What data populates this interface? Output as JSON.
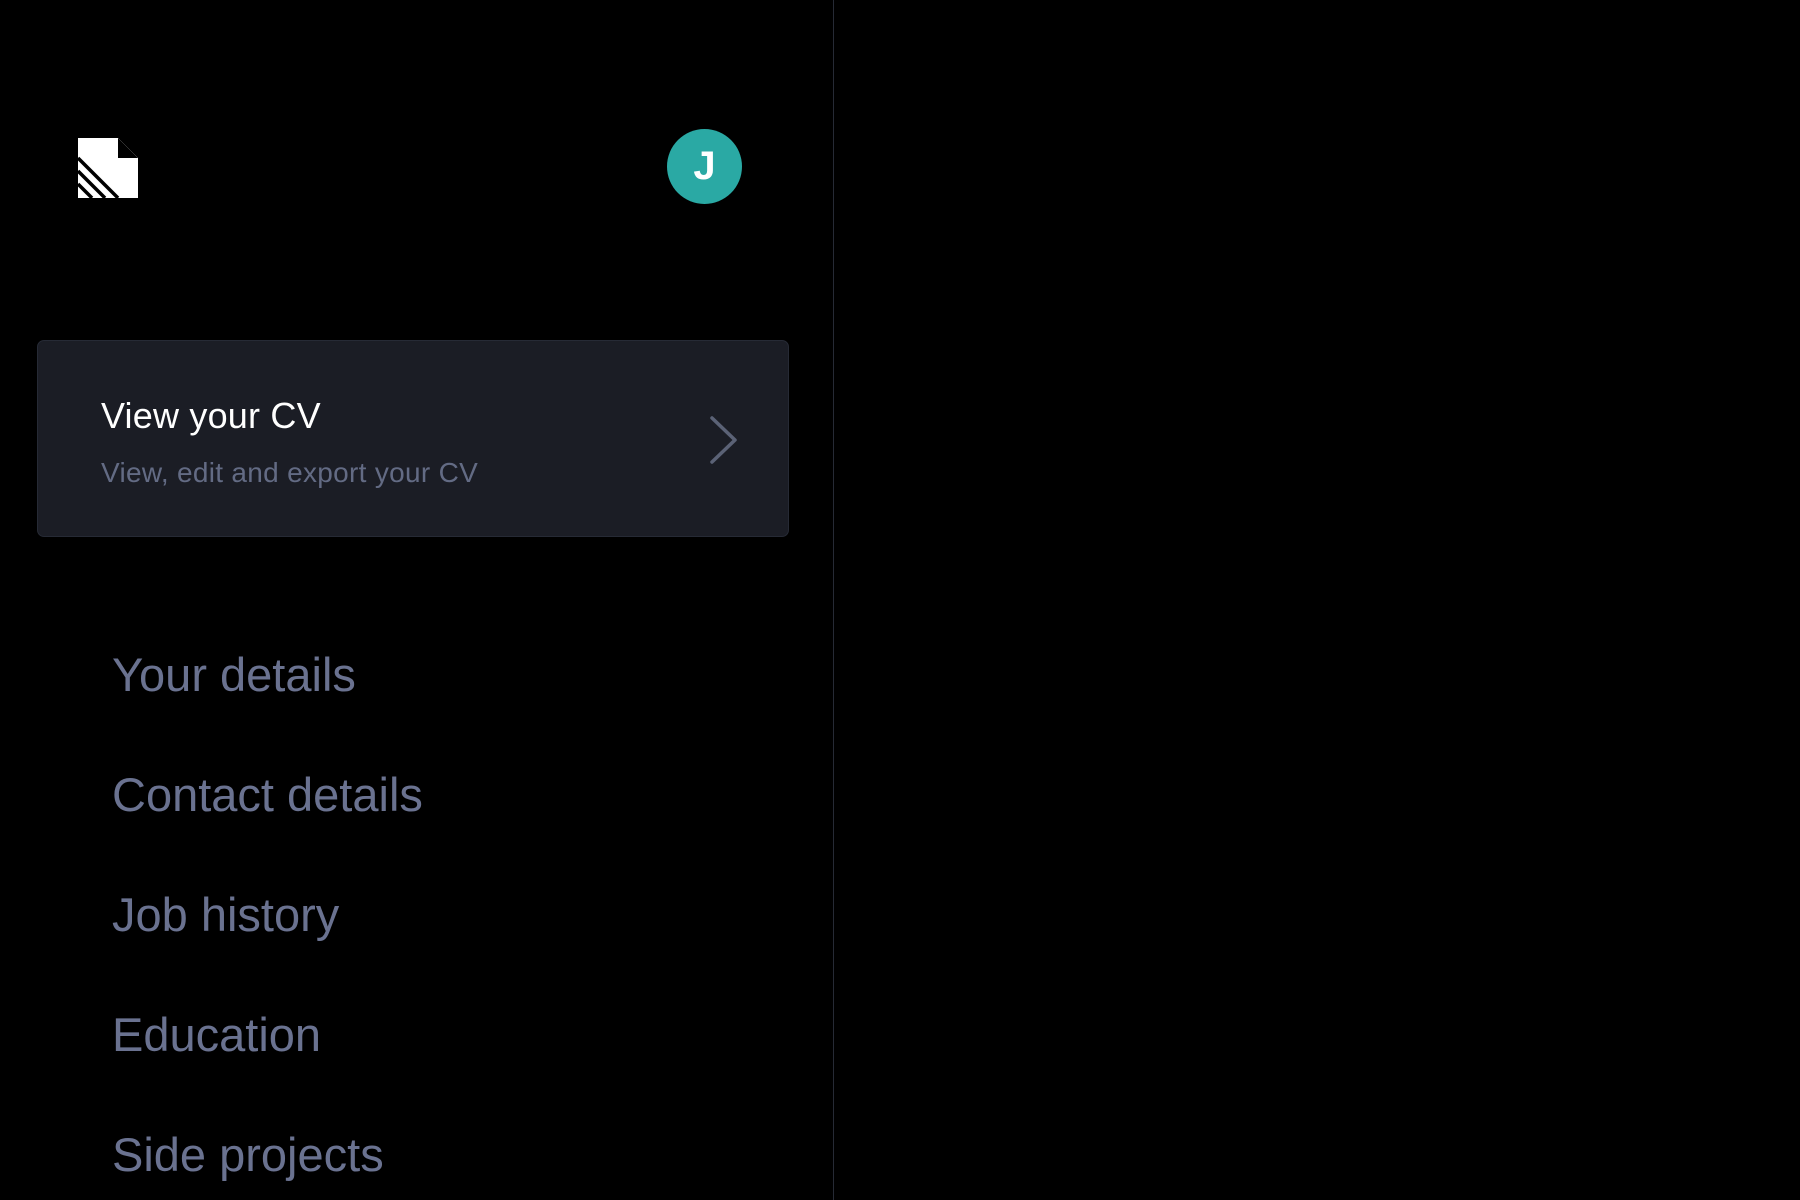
{
  "colors": {
    "background": "#000000",
    "card_background": "#1b1d25",
    "divider": "#262a35",
    "avatar": "#2aa9a4",
    "muted_text": "#636b84",
    "nav_text": "#6a7290"
  },
  "header": {
    "logo_icon": "document-logo-icon",
    "avatar_initial": "J"
  },
  "cv_card": {
    "title": "View your CV",
    "subtitle": "View, edit and export your CV",
    "chevron_icon": "chevron-right-icon"
  },
  "nav": {
    "items": [
      {
        "label": "Your details"
      },
      {
        "label": "Contact details"
      },
      {
        "label": "Job history"
      },
      {
        "label": "Education"
      },
      {
        "label": "Side projects"
      }
    ]
  }
}
